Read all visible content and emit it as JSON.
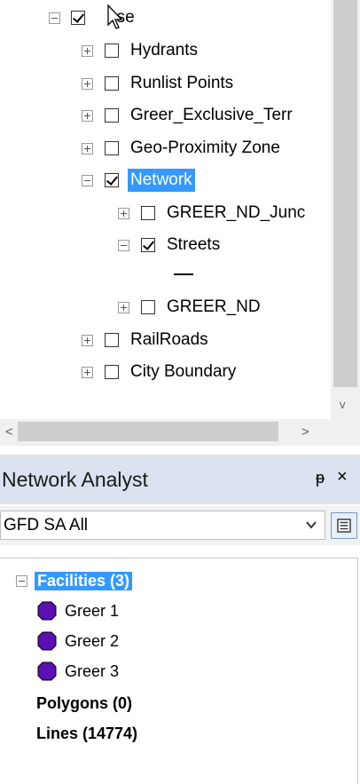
{
  "toc": {
    "items": [
      {
        "label": "ase",
        "level": 0,
        "expander": "minus",
        "checked": true
      },
      {
        "label": "Hydrants",
        "level": 1,
        "expander": "plus",
        "checked": false
      },
      {
        "label": "Runlist Points",
        "level": 1,
        "expander": "plus",
        "checked": false
      },
      {
        "label": "Greer_Exclusive_Terr",
        "level": 1,
        "expander": "plus",
        "checked": false
      },
      {
        "label": "Geo-Proximity Zone",
        "level": 1,
        "expander": "plus",
        "checked": false
      },
      {
        "label": "Network",
        "level": 1,
        "expander": "minus",
        "checked": true,
        "selected": true
      },
      {
        "label": "GREER_ND_Junc",
        "level": 2,
        "expander": "plus",
        "checked": false
      },
      {
        "label": "Streets",
        "level": 2,
        "expander": "minus",
        "checked": true
      },
      {
        "label": "GREER_ND",
        "level": 2,
        "expander": "plus",
        "checked": false
      },
      {
        "label": "RailRoads",
        "level": 1,
        "expander": "plus",
        "checked": false
      },
      {
        "label": "City Boundary",
        "level": 1,
        "expander": "plus",
        "checked": false
      }
    ]
  },
  "network_analyst": {
    "title": "Network Analyst",
    "pin_glyph": "ᵽ",
    "close_glyph": "×",
    "analysis_layer": "GFD SA All",
    "facilities_label": "Facilities (3)",
    "facilities": [
      "Greer 1",
      "Greer 2",
      "Greer 3"
    ],
    "polygons_label": "Polygons (0)",
    "lines_label": "Lines (14774)",
    "facility_color": "#5b0fb5"
  },
  "scrollbar": {
    "left_arrow": "<",
    "right_arrow": ">",
    "down_arrow": "v"
  }
}
